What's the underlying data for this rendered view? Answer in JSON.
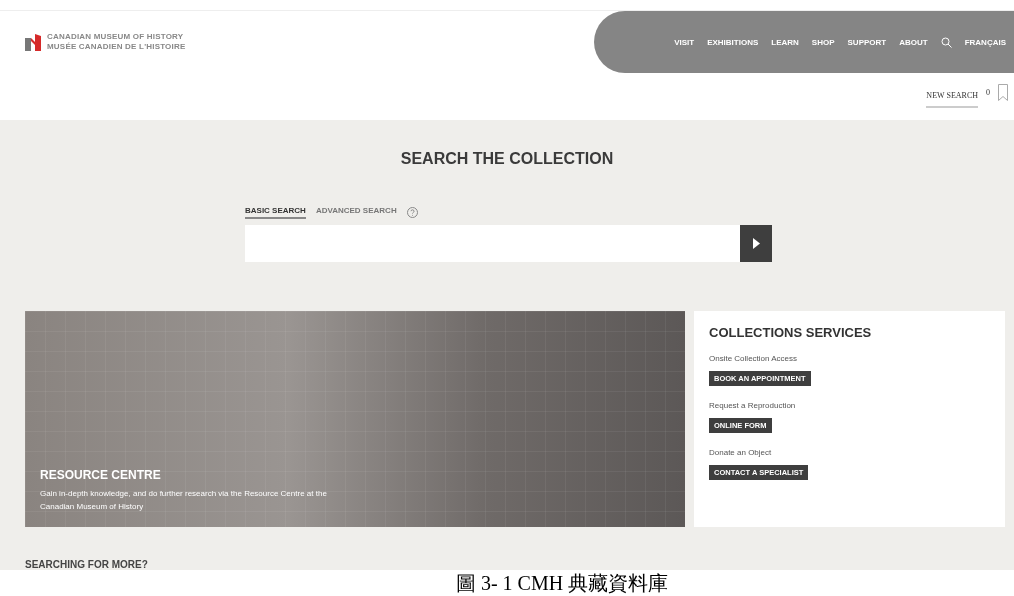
{
  "header": {
    "logo_lines": [
      "CANADIAN MUSEUM OF HISTORY",
      "MUSÉE CANADIEN DE L'HISTOIRE"
    ],
    "nav": [
      "VISIT",
      "EXHIBITIONS",
      "LEARN",
      "SHOP",
      "SUPPORT",
      "ABOUT"
    ],
    "language": "FRANÇAIS"
  },
  "toolbar": {
    "new_search": "NEW SEARCH",
    "saved_count": "0"
  },
  "search": {
    "title": "SEARCH THE COLLECTION",
    "tabs": [
      {
        "label": "BASIC SEARCH",
        "selected": true
      },
      {
        "label": "ADVANCED SEARCH",
        "selected": false
      }
    ]
  },
  "resource_centre": {
    "title": "RESOURCE CENTRE",
    "text": "Gain in-depth knowledge, and do further research via the Resource Centre at the Canadian Museum of History"
  },
  "services": {
    "title": "COLLECTIONS SERVICES",
    "items": [
      {
        "label": "Onsite Collection Access",
        "button": "BOOK AN APPOINTMENT"
      },
      {
        "label": "Request a Reproduction",
        "button": "ONLINE FORM"
      },
      {
        "label": "Donate an Object",
        "button": "CONTACT A SPECIALIST"
      }
    ]
  },
  "more": {
    "title": "SEARCHING FOR MORE?"
  },
  "caption": "圖 3- 1 CMH 典藏資料庫"
}
